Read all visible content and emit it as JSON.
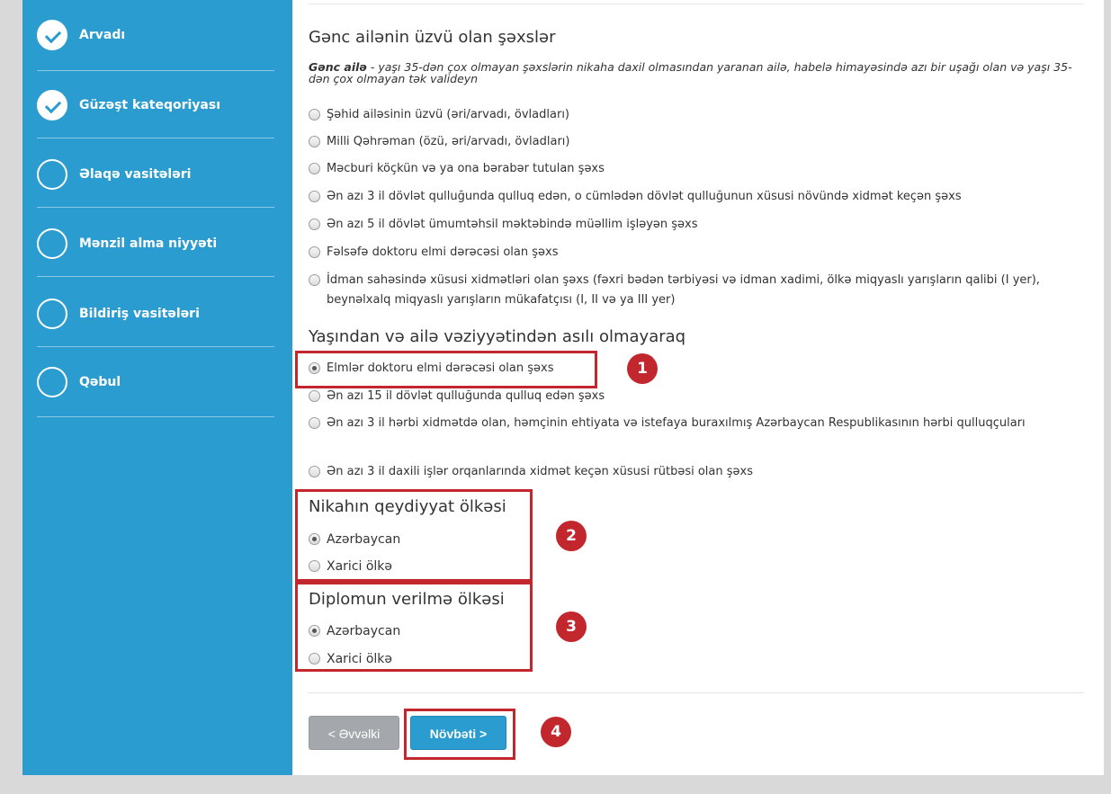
{
  "sidebar": {
    "steps": [
      {
        "label": "Arvadı",
        "status": "completed"
      },
      {
        "label": "Güzəşt kateqoriyası",
        "status": "completed"
      },
      {
        "label": "Əlaqə vasitələri",
        "status": "pending"
      },
      {
        "label": "Mənzil alma niyyəti",
        "status": "pending"
      },
      {
        "label": "Bildiriş vasitələri",
        "status": "pending"
      },
      {
        "label": "Qəbul",
        "status": "pending"
      }
    ]
  },
  "young_family": {
    "heading": "Gənc ailənin üzvü olan şəxslər",
    "description_bold": "Gənc ailə",
    "description_rest": " - yaşı 35-dən çox olmayan şəxslərin nikaha daxil olmasından yaranan ailə, habelə himayəsində azı bir uşağı olan və yaşı 35-dən çox olmayan tək valideyn",
    "options": [
      {
        "label": "Şəhid ailəsinin üzvü (əri/arvadı, övladları)",
        "selected": false
      },
      {
        "label": "Milli Qəhrəman (özü, əri/arvadı, övladları)",
        "selected": false
      },
      {
        "label": "Məcburi köçkün və ya ona bərabər tutulan şəxs",
        "selected": false
      },
      {
        "label": "Ən azı 3 il dövlət qulluğunda qulluq edən, o cümlədən dövlət qulluğunun xüsusi növündə xidmət keçən şəxs",
        "selected": false
      },
      {
        "label": "Ən azı 5 il dövlət ümumtəhsil məktəbində müəllim işləyən şəxs",
        "selected": false
      },
      {
        "label": "Fəlsəfə doktoru elmi dərəcəsi olan şəxs",
        "selected": false
      },
      {
        "label": "İdman sahəsində xüsusi xidmətləri olan şəxs (fəxri bədən tərbiyəsi və idman xadimi, ölkə miqyaslı yarışların qalibi (I yer), beynəlxalq miqyaslı yarışların mükafatçısı (I, II və ya III yer)",
        "selected": false
      }
    ]
  },
  "independent": {
    "heading": "Yaşından və ailə vəziyyətindən asılı olmayaraq",
    "options": [
      {
        "label": "Elmlər doktoru elmi dərəcəsi olan şəxs",
        "selected": true
      },
      {
        "label": "Ən azı 15 il dövlət qulluğunda qulluq edən şəxs",
        "selected": false
      },
      {
        "label": "Ən azı 3 il hərbi xidmətdə olan, həmçinin ehtiyata və istefaya buraxılmış Azərbaycan Respublikasının hərbi qulluqçuları",
        "selected": false
      },
      {
        "label": "Ən azı 3 il daxili işlər orqanlarında xidmət keçən xüsusi rütbəsi olan şəxs",
        "selected": false
      }
    ]
  },
  "marriage_country": {
    "heading": "Nikahın qeydiyyat ölkəsi",
    "options": [
      {
        "label": "Azərbaycan",
        "selected": true
      },
      {
        "label": "Xarici ölkə",
        "selected": false
      }
    ]
  },
  "diploma_country": {
    "heading": "Diplomun verilmə ölkəsi",
    "options": [
      {
        "label": "Azərbaycan",
        "selected": true
      },
      {
        "label": "Xarici ölkə",
        "selected": false
      }
    ]
  },
  "buttons": {
    "prev": "< Əvvəlki",
    "next": "Növbəti >"
  },
  "annotations": [
    "1",
    "2",
    "3",
    "4"
  ],
  "colors": {
    "sidebar": "#2a9cd0",
    "highlight": "#c1272d",
    "button_next": "#2a9cd0",
    "button_prev": "#a4a7ab"
  }
}
